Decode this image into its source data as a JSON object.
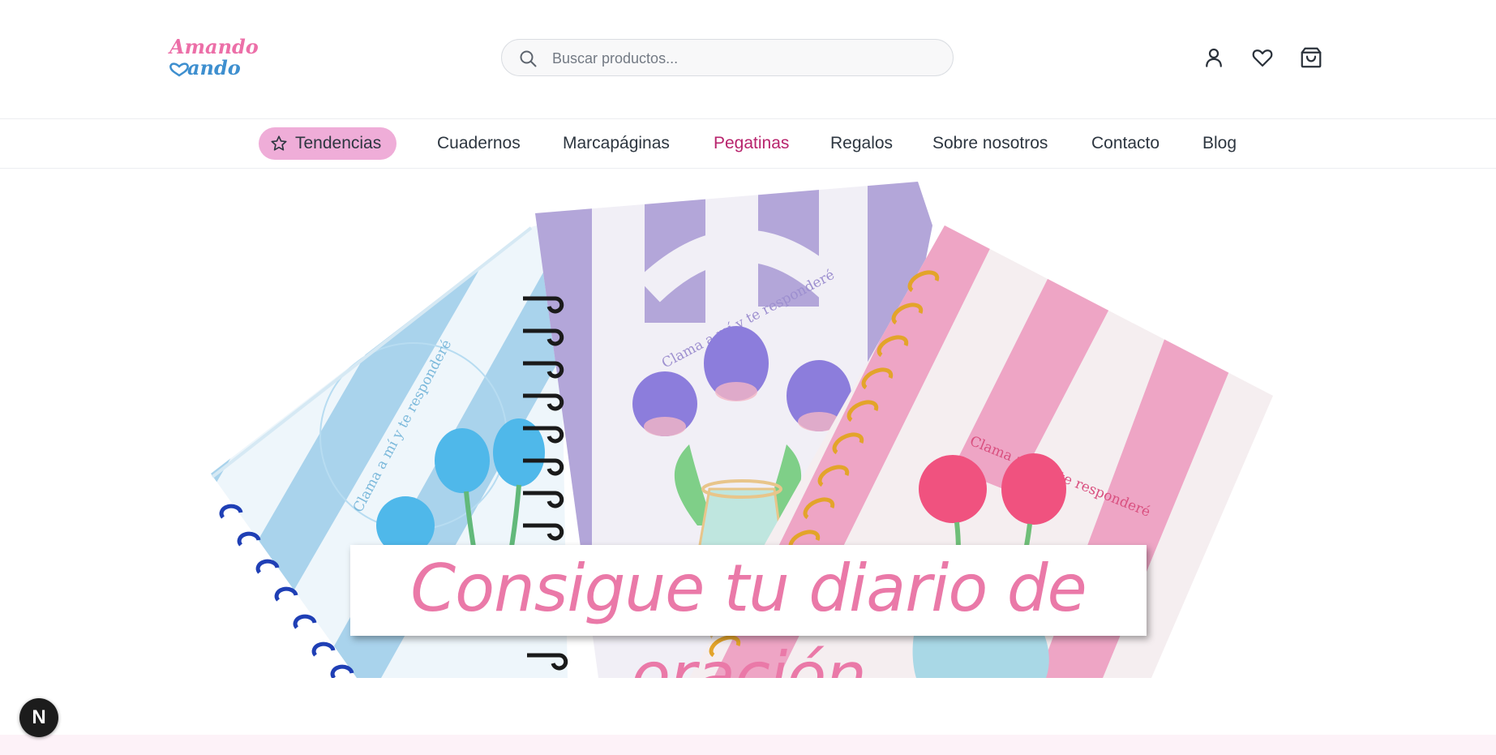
{
  "header": {
    "logo_text_top": "Amando",
    "logo_text_bottom": "ando",
    "search": {
      "placeholder": "Buscar productos...",
      "value": ""
    },
    "icons": [
      "user-icon",
      "heart-icon",
      "shopping-bag-icon"
    ]
  },
  "nav": {
    "items": [
      {
        "label": "Tendencias",
        "icon": "star-icon",
        "highlighted": true
      },
      {
        "label": "Cuadernos"
      },
      {
        "label": "Marcapáginas"
      },
      {
        "label": "Pegatinas",
        "active": true
      },
      {
        "label": "Regalos"
      },
      {
        "label": "Sobre nosotros"
      },
      {
        "label": "Contacto"
      },
      {
        "label": "Blog"
      }
    ]
  },
  "banner": {
    "caption": "Consigue tu diario de oración",
    "notebook_text": "Clama a mí y te responderé"
  },
  "badge": {
    "letter": "N"
  },
  "colors": {
    "accent_pink": "#efadd8",
    "active_nav": "#b8246d",
    "caption_pink": "#ea79a8",
    "blue_notebook": "#a9d3ec",
    "purple_notebook": "#b3a6d9",
    "pink_notebook": "#eea5c5"
  }
}
